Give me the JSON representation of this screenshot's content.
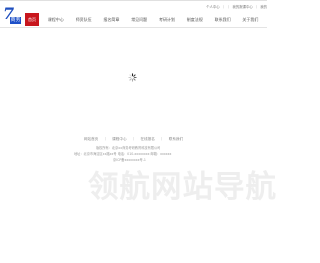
{
  "header": {
    "user_links": [
      "个人中心",
      "｜",
      "｜",
      "我的报课中心",
      "｜",
      "我的"
    ],
    "logo_badge": "商务"
  },
  "nav": {
    "items": [
      {
        "label": "首页",
        "active": true
      },
      {
        "label": "课程中心",
        "active": false
      },
      {
        "label": "师资队伍",
        "active": false
      },
      {
        "label": "报名简章",
        "active": false
      },
      {
        "label": "常见问题",
        "active": false
      },
      {
        "label": "考研计划",
        "active": false
      },
      {
        "label": "制度法规",
        "active": false
      },
      {
        "label": "联系我们",
        "active": false
      },
      {
        "label": "关于我们",
        "active": false
      }
    ]
  },
  "footer": {
    "links": [
      "网站首页",
      "｜",
      "课程中心",
      "｜",
      "在线报名",
      "｜",
      "联系我们"
    ],
    "line1": "版权所有：北京xx商务考研教育科技有限公司",
    "line2": "地址：北京市海淀区xx路xx号 电话：010-xxxxxxxx 邮箱：xxxxxx",
    "line3": "京ICP备xxxxxxxx号-1"
  },
  "watermark": "领航网站导航"
}
